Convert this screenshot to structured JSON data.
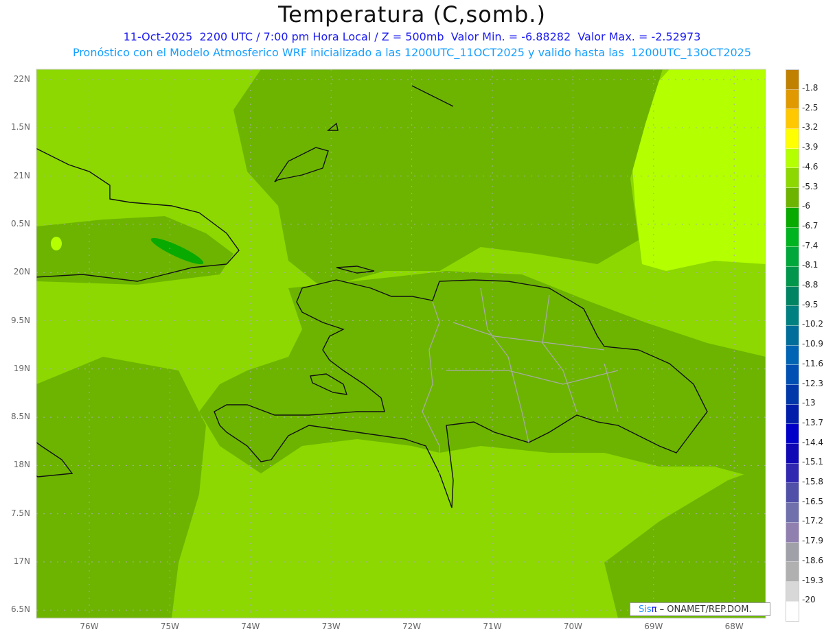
{
  "header": {
    "title": "Temperatura (C,somb.)",
    "subtitle1": "11-Oct-2025  2200 UTC / 7:00 pm Hora Local / Z = 500mb  Valor Min. = -6.88282  Valor Max. = -2.52973",
    "subtitle2": "Pronóstico con el Modelo Atmosferico WRF inicializado a las 1200UTC_11OCT2025 y valido hasta las  1200UTC_13OCT2025"
  },
  "axes": {
    "lat_labels": [
      "22N",
      "1.5N",
      "21N",
      "0.5N",
      "20N",
      "9.5N",
      "19N",
      "8.5N",
      "18N",
      "7.5N",
      "17N",
      "6.5N"
    ],
    "lon_labels": [
      "76W",
      "75W",
      "74W",
      "73W",
      "72W",
      "71W",
      "70W",
      "69W",
      "68W"
    ]
  },
  "colorbar": {
    "labels": [
      "-1.8",
      "-2.5",
      "-3.2",
      "-3.9",
      "-4.6",
      "-5.3",
      "-6",
      "-6.7",
      "-7.4",
      "-8.1",
      "-8.8",
      "-9.5",
      "-10.2",
      "-10.9",
      "-11.6",
      "-12.3",
      "-13",
      "-13.7",
      "-14.4",
      "-15.1",
      "-15.8",
      "-16.5",
      "-17.2",
      "-17.9",
      "-18.6",
      "-19.3",
      "-20"
    ],
    "colors": [
      "#c08000",
      "#e09a00",
      "#ffc800",
      "#ffff00",
      "#b4ff00",
      "#8cd800",
      "#6cb400",
      "#08aa00",
      "#00b420",
      "#00a83c",
      "#00964c",
      "#008464",
      "#008080",
      "#006e9a",
      "#0064b4",
      "#0050b4",
      "#0038aa",
      "#001eaa",
      "#0000c8",
      "#1008b4",
      "#3028b0",
      "#5050a8",
      "#7070ac",
      "#9080b0",
      "#a0a0a8",
      "#b0b0b0",
      "#d8d8d8",
      "#ffffff"
    ]
  },
  "credit": {
    "brand": "Sis",
    "pi": "π",
    "text": " –  ONAMET/REP.DOM."
  }
}
